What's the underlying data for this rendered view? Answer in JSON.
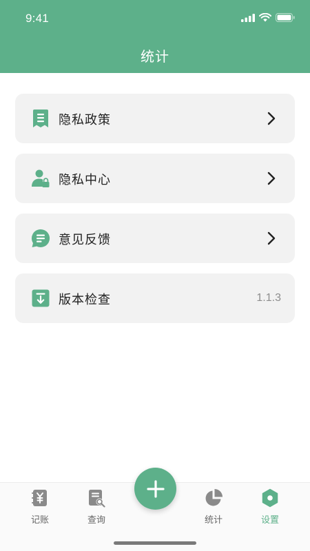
{
  "status_bar": {
    "time": "9:41"
  },
  "header": {
    "title": "统计"
  },
  "menu": {
    "items": [
      {
        "label": "隐私政策",
        "icon": "document-list-icon"
      },
      {
        "label": "隐私中心",
        "icon": "user-lock-icon"
      },
      {
        "label": "意见反馈",
        "icon": "chat-bubble-icon"
      },
      {
        "label": "版本检查",
        "icon": "download-box-icon",
        "value": "1.1.3"
      }
    ]
  },
  "tabbar": {
    "tabs": [
      {
        "label": "记账",
        "icon": "yen-ledger-icon"
      },
      {
        "label": "查询",
        "icon": "search-document-icon"
      },
      {
        "label": "统计",
        "icon": "pie-chart-icon"
      },
      {
        "label": "设置",
        "icon": "hexagon-settings-icon",
        "active": true
      }
    ],
    "fab_icon": "plus-icon"
  },
  "colors": {
    "accent": "#5db08a",
    "card_bg": "#f2f2f2",
    "text": "#222222",
    "muted": "#8d8d8d",
    "tab_icon": "#8a8a8a"
  }
}
